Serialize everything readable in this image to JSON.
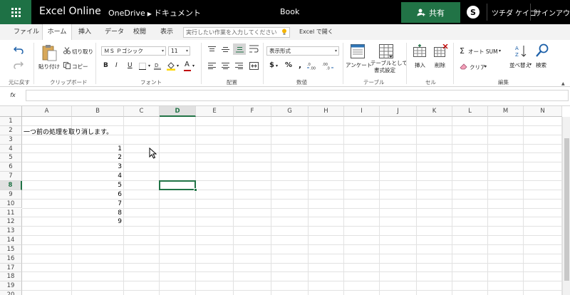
{
  "topbar": {
    "app_name": "Excel Online",
    "breadcrumb": [
      "OneDrive",
      "ドキュメント"
    ],
    "doc_title": "Book",
    "share_label": "共有",
    "skype_letter": "S",
    "user_name": "ツチダ ケイゴ",
    "signout_label": "サインアウト"
  },
  "tabs": [
    "ファイル",
    "ホーム",
    "挿入",
    "データ",
    "校閲",
    "表示"
  ],
  "tellme_placeholder": "実行したい作業を入力してください",
  "open_in_excel": "Excel で開く",
  "ribbon": {
    "undo_label": "元に戻す",
    "paste_label": "貼り付け",
    "cut_label": "切り取り",
    "copy_label": "コピー",
    "font_name": "ＭＳ Ｐゴシック",
    "font_size": "11",
    "bold": "B",
    "italic": "I",
    "underline": "U",
    "font_color_letter": "A",
    "number_format": "表示形式",
    "currency": "$",
    "percent": "%",
    "comma": ",",
    "survey_label": "アンケート",
    "table_format_label1": "テーブルとして",
    "table_format_label2": "書式設定",
    "insert_label": "挿入",
    "delete_label": "削除",
    "autosum_label": "オート SUM",
    "clear_label": "クリア",
    "sort_label": "並べ替え",
    "find_label": "検索",
    "groups": [
      "元に戻す",
      "クリップボード",
      "フォント",
      "配置",
      "数値",
      "テーブル",
      "セル",
      "編集"
    ],
    "fill_color": "#ffd700",
    "font_color": "#c00000"
  },
  "formula_bar": {
    "fx_label": "fx",
    "value": ""
  },
  "grid": {
    "columns": [
      "A",
      "B",
      "C",
      "D",
      "E",
      "F",
      "G",
      "H",
      "I",
      "J",
      "K",
      "L",
      "M",
      "N"
    ],
    "rows": [
      "1",
      "2",
      "3",
      "4",
      "5",
      "6",
      "7",
      "8",
      "9",
      "10",
      "11",
      "12",
      "13",
      "14",
      "15",
      "16",
      "17",
      "18",
      "19",
      "20"
    ],
    "selected_cell": "D8",
    "a2_text": "一つ前の処理を取り消します。",
    "b_values": [
      "1",
      "2",
      "3",
      "4",
      "5",
      "6",
      "7",
      "8",
      "9"
    ],
    "accent": "#217346"
  }
}
